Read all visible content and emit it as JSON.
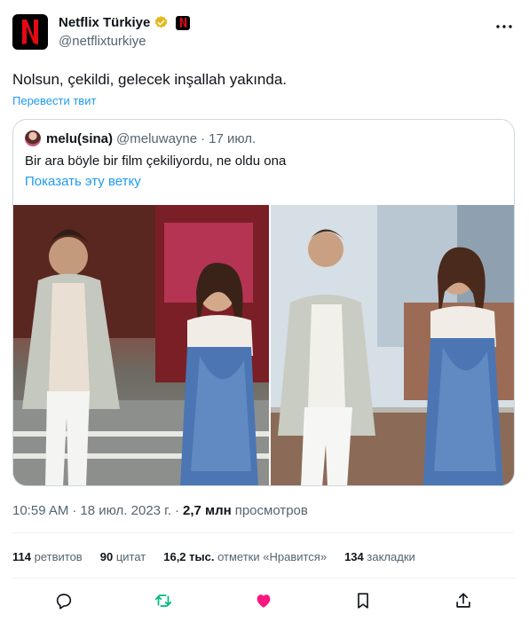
{
  "author": {
    "name": "Netflix Türkiye",
    "handle": "@netflixturkiye",
    "avatar_letter": "N",
    "brand_color": "#e50914",
    "verified_color": "#e2b719"
  },
  "tweet": {
    "text": "Nolsun, çekildi, gelecek inşallah yakında.",
    "translate_label": "Перевести твит"
  },
  "quote": {
    "name": "melu(sina)",
    "handle": "@meluwayne",
    "separator": "·",
    "date": "17 июл.",
    "text": "Bir ara böyle bir film çekiliyordu, ne oldu ona",
    "show_thread_label": "Показать эту ветку"
  },
  "meta": {
    "time": "10:59 AM",
    "separator": "·",
    "date": "18 июл. 2023 г.",
    "separator2": "·",
    "views_count": "2,7 млн",
    "views_label": "просмотров"
  },
  "stats": [
    {
      "count": "114",
      "label": "ретвитов"
    },
    {
      "count": "90",
      "label": "цитат"
    },
    {
      "count": "16,2 тыс.",
      "label": "отметки «Нравится»"
    },
    {
      "count": "134",
      "label": "закладки"
    }
  ],
  "actions": [
    {
      "icon": "reply-icon"
    },
    {
      "icon": "retweet-icon",
      "color": "#00ba7c"
    },
    {
      "icon": "like-icon",
      "color": "#f91880"
    },
    {
      "icon": "bookmark-icon"
    },
    {
      "icon": "share-icon"
    }
  ]
}
